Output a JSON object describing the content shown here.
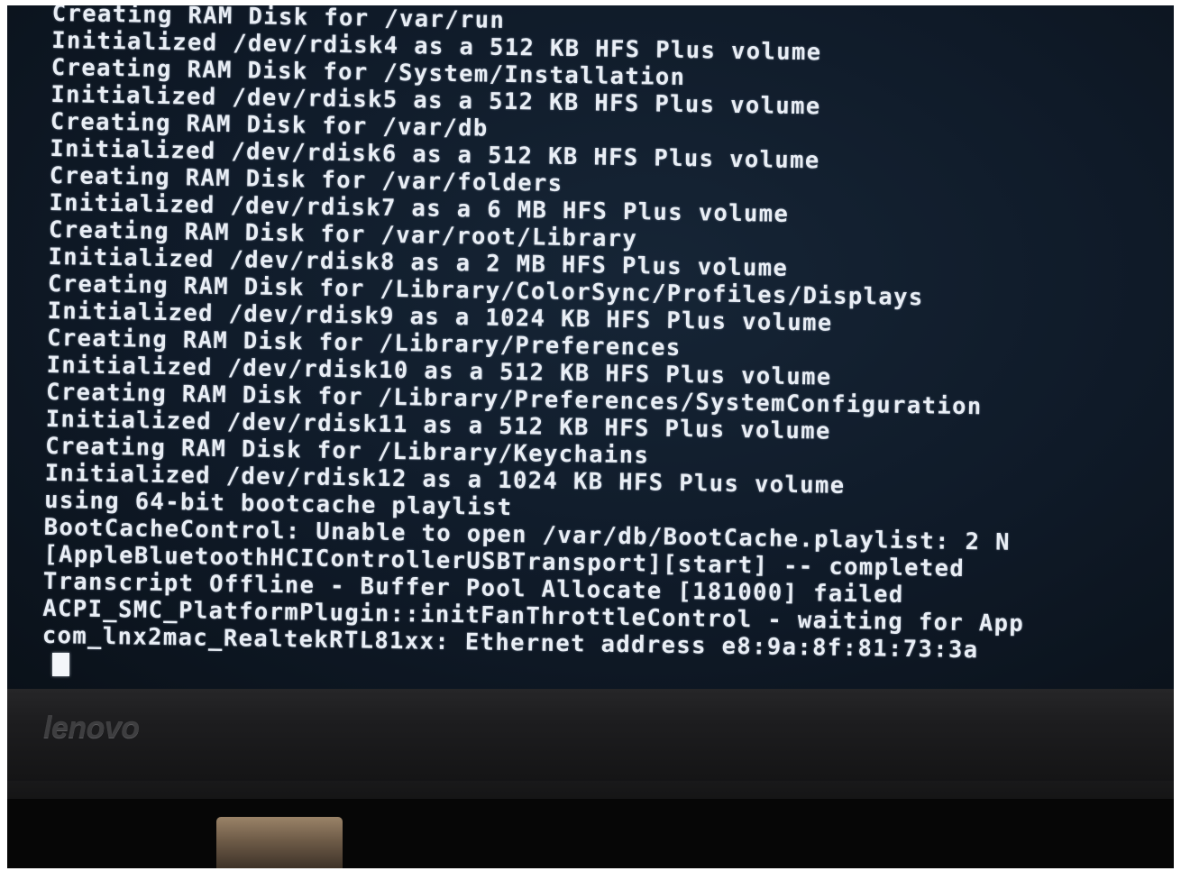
{
  "terminal": {
    "lines": [
      "Creating RAM Disk for /var/run",
      "Initialized /dev/rdisk4 as a 512 KB HFS Plus volume",
      "Creating RAM Disk for /System/Installation",
      "Initialized /dev/rdisk5 as a 512 KB HFS Plus volume",
      "Creating RAM Disk for /var/db",
      "Initialized /dev/rdisk6 as a 512 KB HFS Plus volume",
      "Creating RAM Disk for /var/folders",
      "Initialized /dev/rdisk7 as a 6 MB HFS Plus volume",
      "Creating RAM Disk for /var/root/Library",
      "Initialized /dev/rdisk8 as a 2 MB HFS Plus volume",
      "Creating RAM Disk for /Library/ColorSync/Profiles/Displays",
      "Initialized /dev/rdisk9 as a 1024 KB HFS Plus volume",
      "Creating RAM Disk for /Library/Preferences",
      "Initialized /dev/rdisk10 as a 512 KB HFS Plus volume",
      "Creating RAM Disk for /Library/Preferences/SystemConfiguration",
      "Initialized /dev/rdisk11 as a 512 KB HFS Plus volume",
      "Creating RAM Disk for /Library/Keychains",
      "Initialized /dev/rdisk12 as a 1024 KB HFS Plus volume",
      "using 64-bit bootcache playlist",
      "BootCacheControl: Unable to open /var/db/BootCache.playlist: 2 N",
      "[AppleBluetoothHCIControllerUSBTransport][start] -- completed",
      "Transcript Offline - Buffer Pool Allocate [181000] failed",
      "ACPI_SMC_PlatformPlugin::initFanThrottleControl - waiting for App",
      "com_lnx2mac_RealtekRTL81xx: Ethernet address e8:9a:8f:81:73:3a"
    ]
  },
  "bezel": {
    "brand": "lenovo"
  },
  "colors": {
    "screen_background": "#0f1a28",
    "text": "#e9eef5",
    "bezel": "#1d1d1f",
    "brand_text": "#3e3e40"
  }
}
